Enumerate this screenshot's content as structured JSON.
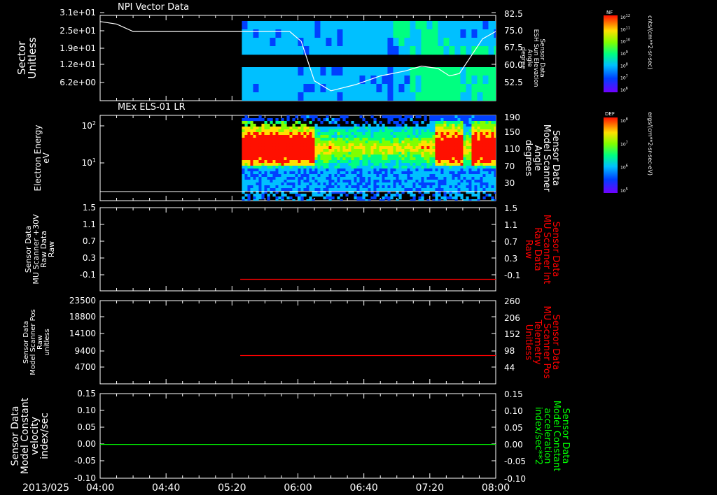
{
  "panels": [
    {
      "id": "npi",
      "title": "NPI Vector Data",
      "left_label": [
        "Sector",
        "Unitless"
      ],
      "left_ticks": [
        "3.1e+01",
        "2.5e+01",
        "1.9e+01",
        "1.2e+01",
        "6.2e+00"
      ],
      "right_label": [
        "Sensor Data",
        "ESH Sun Elevation",
        "Angle",
        "degree"
      ],
      "right_ticks": [
        "82.5",
        "75.0",
        "67.5",
        "60.0",
        "52.5"
      ],
      "right_color": "#ffffff",
      "colorbar": {
        "label": "NF",
        "ticks": [
          "10^12",
          "10^11",
          "10^10",
          "10^9",
          "10^8",
          "10^7",
          "10^6"
        ],
        "units": "cnts/(cm**2-sr-sec)"
      }
    },
    {
      "id": "els",
      "title": "MEx ELS-01 LR",
      "left_label": [
        "Electron Energy",
        "eV"
      ],
      "left_ticks": [
        "10^2",
        "10^1"
      ],
      "right_label": [
        "Sensor Data",
        "Model Scanner",
        "Angle",
        "degrees"
      ],
      "right_ticks": [
        "190",
        "150",
        "110",
        "70",
        "30"
      ],
      "right_color": "#ffffff",
      "colorbar": {
        "label": "DEF",
        "ticks": [
          "10^8",
          "10^7",
          "10^6",
          "10^5"
        ],
        "units": "ergs/(cm**2-sr-sec-eV)"
      }
    },
    {
      "id": "mu_int",
      "left_label": [
        "Sensor Data",
        "MU Scanner +30V",
        "Raw Data",
        "Raw"
      ],
      "left_ticks": [
        "1.5",
        "1.1",
        "0.7",
        "0.3",
        "-0.1"
      ],
      "right_label": [
        "Sensor Data",
        "MU Scanner Int",
        "Raw Data",
        "Raw"
      ],
      "right_ticks": [
        "1.5",
        "1.1",
        "0.7",
        "0.3",
        "-0.1"
      ],
      "right_color": "#ff0000"
    },
    {
      "id": "scanner_pos",
      "left_label": [
        "Sensor Data",
        "Model Scanner Pos",
        "Raw",
        "unitless"
      ],
      "left_ticks": [
        "23500",
        "18800",
        "14100",
        "9400",
        "4700"
      ],
      "right_label": [
        "Sensor Data",
        "MU Scanner Pos",
        "Telemetry",
        "Unitless"
      ],
      "right_ticks": [
        "260",
        "206",
        "152",
        "98",
        "44"
      ],
      "right_color": "#ff0000"
    },
    {
      "id": "model_const",
      "left_label": [
        "Sensor Data",
        "Model Constant",
        "velocity",
        "index/sec"
      ],
      "left_ticks": [
        "0.15",
        "0.10",
        "0.05",
        "0.00",
        "-0.05",
        "-0.10"
      ],
      "right_label": [
        "Sensor Data",
        "Model Constant",
        "acceleration",
        "index/sec**2"
      ],
      "right_ticks": [
        "0.15",
        "0.10",
        "0.05",
        "0.00",
        "-0.05",
        "-0.10"
      ],
      "right_color": "#00ff00"
    }
  ],
  "time_axis": {
    "date": "2013/025",
    "ticks": [
      "04:00",
      "04:40",
      "05:20",
      "06:00",
      "06:40",
      "07:20",
      "08:00"
    ]
  },
  "chart_data": [
    {
      "type": "line",
      "panel": "npi",
      "title": "NPI Vector Data",
      "series": [
        {
          "color": "#ffffff",
          "x": [
            "04:00",
            "04:10",
            "04:20",
            "05:20",
            "05:55",
            "06:02",
            "06:10",
            "06:20",
            "06:35",
            "06:50",
            "07:05",
            "07:15",
            "07:25",
            "07:32",
            "07:38",
            "07:45",
            "07:52",
            "08:00"
          ],
          "values": [
            80,
            79,
            76,
            76,
            76,
            72,
            56,
            52,
            54.5,
            58,
            60,
            62,
            61,
            58,
            59,
            66,
            73,
            76
          ]
        }
      ],
      "ylim": [
        48,
        82.5
      ],
      "ylabel": "ESH Sun Elevation Angle (degree)"
    },
    {
      "type": "heatmap",
      "panel": "els",
      "title": "MEx ELS-01 LR",
      "xlim": [
        "05:26",
        "08:00"
      ],
      "ylim_eV": [
        1,
        200
      ],
      "intense_band_eV": [
        15,
        60
      ],
      "intense_intervals": [
        [
          "05:26",
          "06:10"
        ],
        [
          "07:23",
          "07:40"
        ],
        [
          "07:45",
          "08:00"
        ]
      ]
    },
    {
      "type": "line",
      "panel": "mu_int",
      "series": [
        {
          "color": "#ff0000",
          "x": [
            "05:25",
            "08:00"
          ],
          "values": [
            -0.05,
            -0.05
          ]
        }
      ],
      "ylim": [
        -0.3,
        1.5
      ]
    },
    {
      "type": "line",
      "panel": "scanner_pos",
      "series": [
        {
          "color": "#ff0000",
          "x": [
            "05:25",
            "08:00"
          ],
          "values": [
            8000,
            8000
          ]
        }
      ],
      "ylim": [
        0,
        23500
      ]
    },
    {
      "type": "line",
      "panel": "model_const",
      "series": [
        {
          "color": "#00ff00",
          "x": [
            "04:00",
            "08:00"
          ],
          "values": [
            0,
            0
          ]
        }
      ],
      "ylim": [
        -0.1,
        0.15
      ]
    }
  ]
}
